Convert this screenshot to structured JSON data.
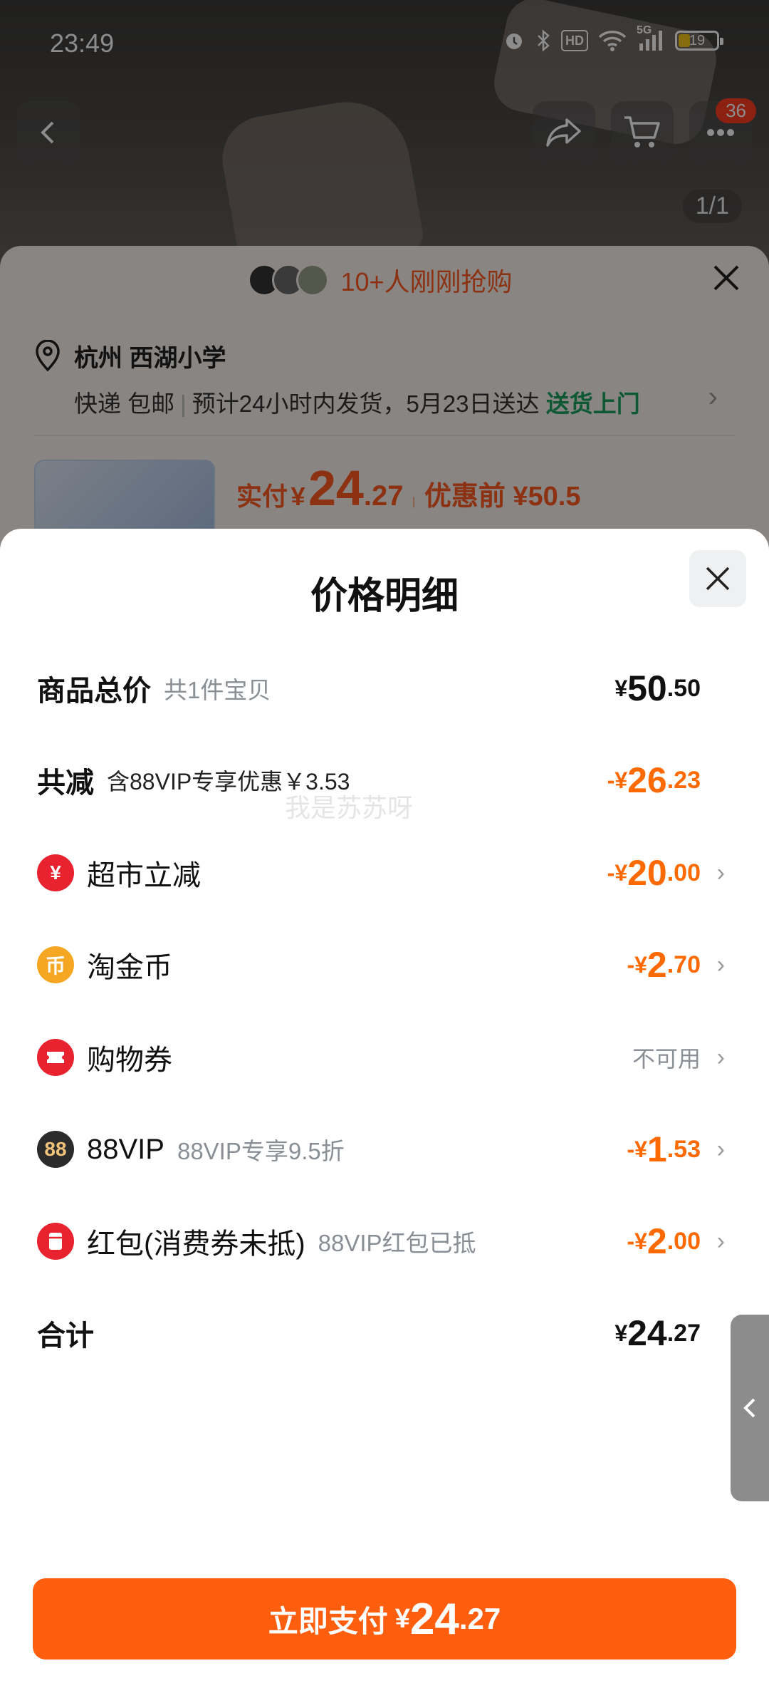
{
  "status_bar": {
    "time": "23:49",
    "battery": "19",
    "network": "5G",
    "hd": "HD"
  },
  "product_view": {
    "cart_badge": "36",
    "pager": "1/1"
  },
  "order_card": {
    "buyers_text": "10+人刚刚抢购",
    "address_title": "杭州 西湖小学",
    "shipping": "快递 包邮",
    "delivery_estimate": "预计24小时内发货，5月23日送达",
    "delivery_tag": "送货上门",
    "paid_label": "实付",
    "paid_symbol": "¥",
    "paid_int": "24",
    "paid_dec": ".27",
    "pre_discount": "优惠前 ¥50.5"
  },
  "sheet": {
    "title": "价格明细",
    "total": {
      "label": "商品总价",
      "sub": "共1件宝贝",
      "symbol": "¥",
      "int": "50",
      "dec": ".50"
    },
    "reduce": {
      "label": "共减",
      "sub": "含88VIP专享优惠￥3.53",
      "symbol": "-¥",
      "int": "26",
      "dec": ".23"
    },
    "items": [
      {
        "label": "超市立减",
        "sub": "",
        "symbol": "-¥",
        "int": "20",
        "dec": ".00",
        "icon": "yuan-icon",
        "color": "#e8222f"
      },
      {
        "label": "淘金币",
        "sub": "",
        "symbol": "-¥",
        "int": "2",
        "dec": ".70",
        "icon": "coin-icon",
        "color": "#f5a623"
      },
      {
        "label": "购物券",
        "sub": "",
        "text_value": "不可用",
        "icon": "ticket-icon",
        "color": "#e8222f"
      },
      {
        "label": "88VIP",
        "sub": "88VIP专享9.5折",
        "symbol": "-¥",
        "int": "1",
        "dec": ".53",
        "icon": "vip-icon",
        "color": "#2b2b2b"
      },
      {
        "label": "红包(消费券未抵)",
        "sub": "88VIP红包已抵",
        "symbol": "-¥",
        "int": "2",
        "dec": ".00",
        "icon": "red-packet-icon",
        "color": "#e8222f"
      }
    ],
    "sum": {
      "label": "合计",
      "symbol": "¥",
      "int": "24",
      "dec": ".27"
    },
    "watermark": "我是苏苏呀"
  },
  "pay_button": {
    "label": "立即支付",
    "symbol": "¥",
    "int": "24",
    "dec": ".27"
  }
}
